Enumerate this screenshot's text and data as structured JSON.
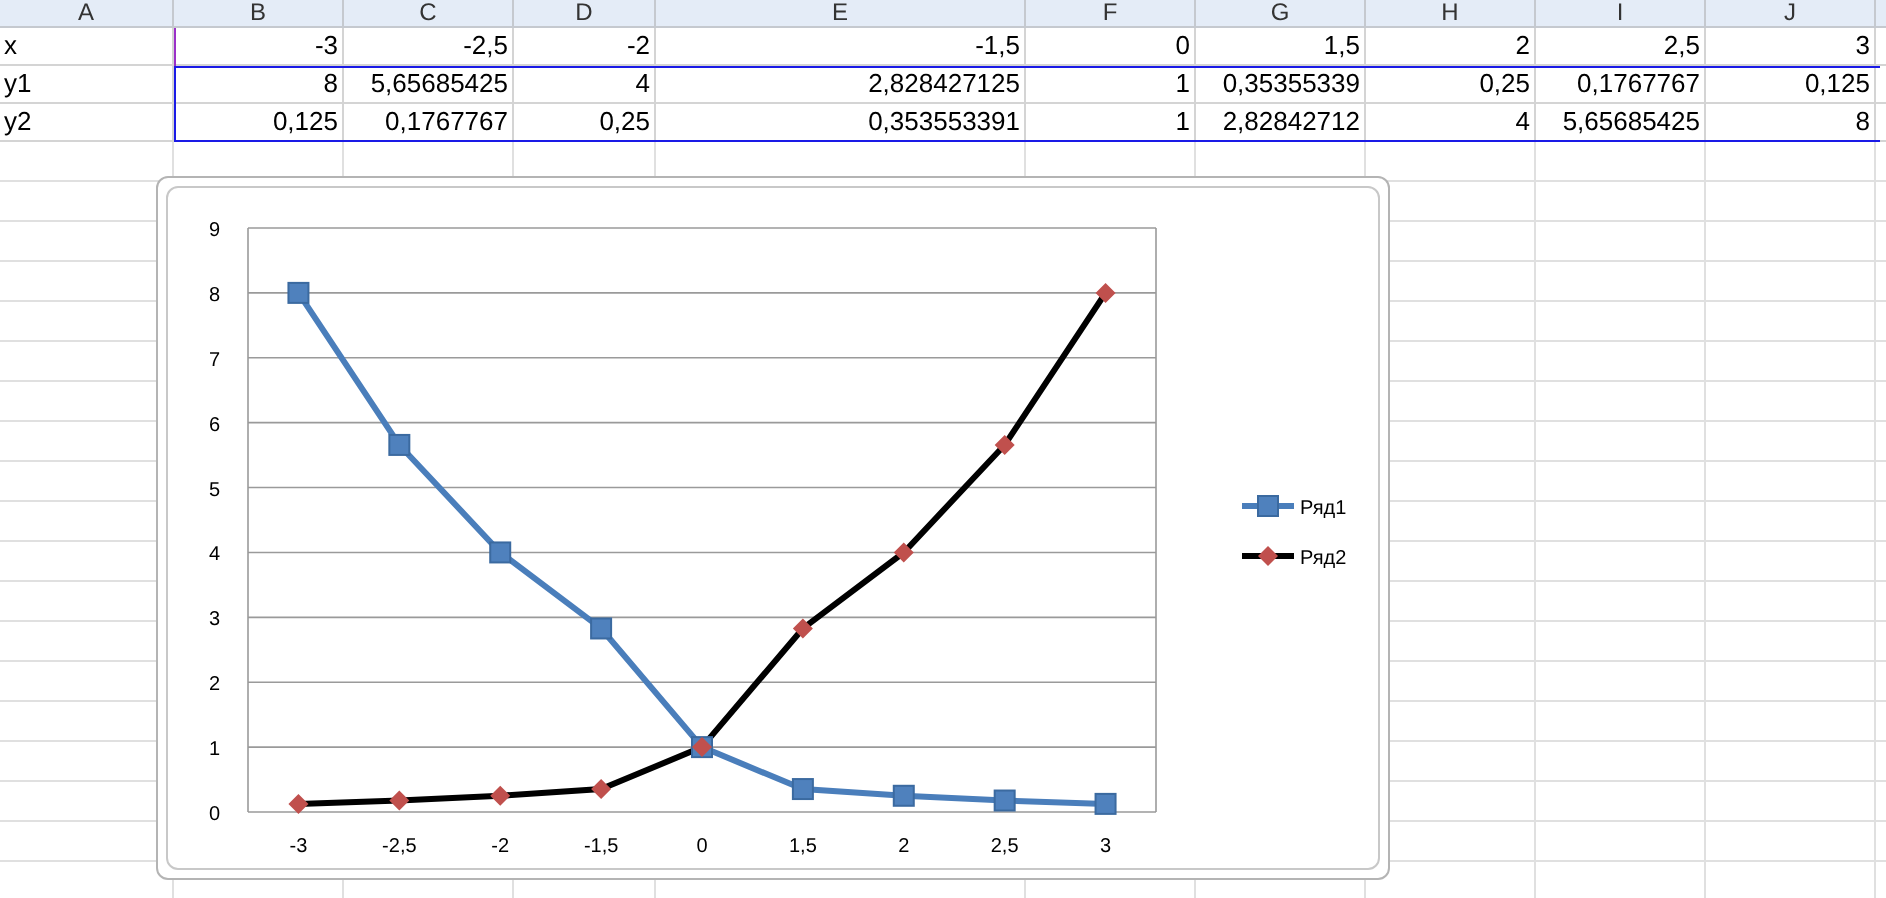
{
  "columns": [
    "A",
    "B",
    "C",
    "D",
    "E",
    "F",
    "G",
    "H",
    "I",
    "J"
  ],
  "rows": [
    {
      "cells": [
        "x",
        "-3",
        "-2,5",
        "-2",
        "-1,5",
        "0",
        "1,5",
        "2",
        "2,5",
        "3"
      ]
    },
    {
      "cells": [
        "y1",
        "8",
        "5,65685425",
        "4",
        "2,828427125",
        "1",
        "0,35355339",
        "0,25",
        "0,1767767",
        "0,125"
      ]
    },
    {
      "cells": [
        "y2",
        "0,125",
        "0,1767767",
        "0,25",
        "0,353553391",
        "1",
        "2,82842712",
        "4",
        "5,65685425",
        "8"
      ]
    }
  ],
  "chart": {
    "chart_data": {
      "type": "line",
      "categories": [
        "-3",
        "-2,5",
        "-2",
        "-1,5",
        "0",
        "1,5",
        "2",
        "2,5",
        "3"
      ],
      "ylim": [
        0,
        9
      ],
      "yticks": [
        {
          "value": 0,
          "label": "0"
        },
        {
          "value": 1,
          "label": "1"
        },
        {
          "value": 2,
          "label": "2"
        },
        {
          "value": 3,
          "label": "3"
        },
        {
          "value": 4,
          "label": "4"
        },
        {
          "value": 5,
          "label": "5"
        },
        {
          "value": 6,
          "label": "6"
        },
        {
          "value": 7,
          "label": "7"
        },
        {
          "value": 8,
          "label": "8"
        },
        {
          "value": 9,
          "label": "9"
        }
      ],
      "grid": true,
      "legend": true,
      "series": [
        {
          "name": "Ряд1",
          "color": "#4a7ebb",
          "marker": "square",
          "values": [
            8,
            5.65685425,
            4,
            2.828427125,
            1,
            0.35355339,
            0.25,
            0.1767767,
            0.125
          ]
        },
        {
          "name": "Ряд2",
          "color": "#000000",
          "marker": "diamond",
          "values": [
            0.125,
            0.1767767,
            0.25,
            0.353553391,
            1,
            2.82842712,
            4,
            5.65685425,
            8
          ]
        }
      ]
    }
  }
}
